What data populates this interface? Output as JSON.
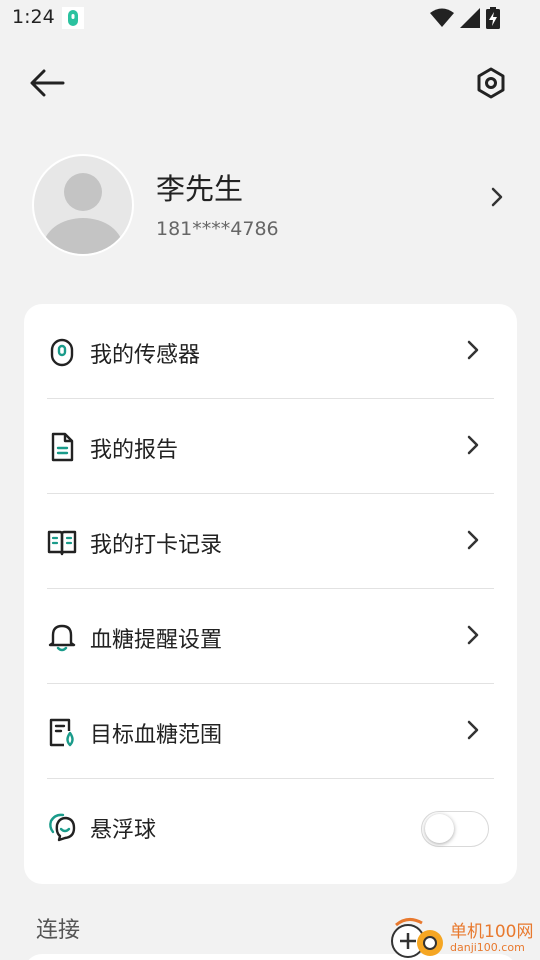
{
  "status_bar": {
    "time": "1:24",
    "icons": [
      "app-notification-icon",
      "wifi-icon",
      "signal-icon",
      "battery-charging-icon"
    ]
  },
  "header": {
    "back_icon": "arrow-left-icon",
    "settings_icon": "hexagon-settings-icon"
  },
  "profile": {
    "name": "李先生",
    "phone": "181****4786"
  },
  "menu": {
    "items": [
      {
        "label": "我的传感器",
        "icon": "sensor-icon"
      },
      {
        "label": "我的报告",
        "icon": "report-document-icon"
      },
      {
        "label": "我的打卡记录",
        "icon": "open-book-icon"
      },
      {
        "label": "血糖提醒设置",
        "icon": "bell-icon"
      },
      {
        "label": "目标血糖范围",
        "icon": "glucose-target-icon"
      },
      {
        "label": "悬浮球",
        "icon": "floating-ball-icon",
        "toggle_on": false
      }
    ]
  },
  "connect_section": {
    "title": "连接"
  },
  "watermark": {
    "line1": "单机100网",
    "line2": "danji100.com"
  },
  "colors": {
    "accent": "#1a9b8a",
    "background": "#f2f2f2",
    "card": "#ffffff",
    "watermark": "#e8792e"
  }
}
